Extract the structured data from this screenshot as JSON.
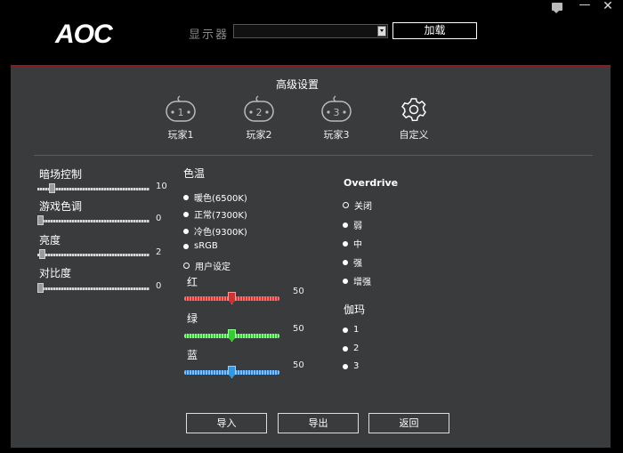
{
  "header": {
    "logo": "AOC",
    "display_label": "显示器",
    "display_value": "",
    "load_button": "加载"
  },
  "panel": {
    "title": "高级设置",
    "presets": [
      {
        "label": "玩家1",
        "icon": "gamepad-1-icon"
      },
      {
        "label": "玩家2",
        "icon": "gamepad-2-icon"
      },
      {
        "label": "玩家3",
        "icon": "gamepad-3-icon"
      },
      {
        "label": "自定义",
        "icon": "gear-icon"
      }
    ]
  },
  "left_controls": [
    {
      "label": "暗场控制",
      "value": "10",
      "level": 0.14
    },
    {
      "label": "游戏色调",
      "value": "0",
      "level": 0.0
    },
    {
      "label": "亮度",
      "value": "2",
      "level": 0.02
    },
    {
      "label": "对比度",
      "value": "0",
      "level": 0.0
    }
  ],
  "color_temp": {
    "label": "色温",
    "options": [
      "暖色(6500K)",
      "正常(7300K)",
      "冷色(9300K)",
      "sRGB",
      "用户设定"
    ],
    "selected": 4
  },
  "rgb": [
    {
      "label": "红",
      "value": "50",
      "color": "#e23b3b"
    },
    {
      "label": "绿",
      "value": "50",
      "color": "#38c43b"
    },
    {
      "label": "蓝",
      "value": "50",
      "color": "#3b8ee2"
    }
  ],
  "overdrive": {
    "label": "Overdrive",
    "options": [
      "关闭",
      "弱",
      "中",
      "强",
      "增强"
    ],
    "selected": 0
  },
  "gamma": {
    "label": "伽玛",
    "options": [
      "1",
      "2",
      "3"
    ]
  },
  "buttons": {
    "import": "导入",
    "export": "导出",
    "back": "返回"
  }
}
